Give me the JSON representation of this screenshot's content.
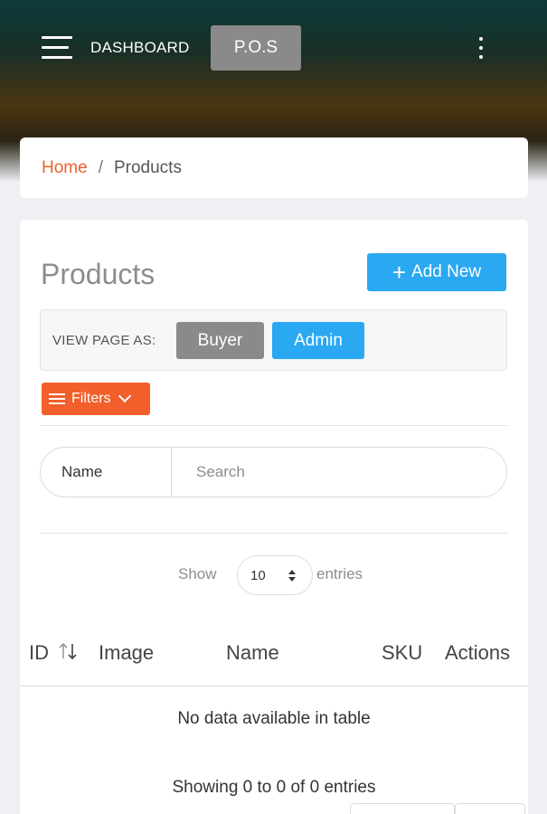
{
  "header": {
    "dashboard_label": "DASHBOARD",
    "pos_label": "P.O.S"
  },
  "breadcrumb": {
    "home": "Home",
    "separator": "/",
    "current": "Products"
  },
  "products": {
    "title": "Products",
    "add_new_label": "Add New",
    "view_page_as_label": "VIEW PAGE AS:",
    "buyer_label": "Buyer",
    "admin_label": "Admin",
    "filters_label": "Filters",
    "search": {
      "field_label": "Name",
      "placeholder": "Search"
    },
    "show_label": "Show",
    "entries_value": "10",
    "entries_label": "entries",
    "table": {
      "columns": [
        "ID",
        "Image",
        "Name",
        "SKU",
        "Actions"
      ],
      "empty_message": "No data available in table",
      "info": "Showing 0 to 0 of 0 entries"
    }
  },
  "colors": {
    "accent_orange": "#f25f2a",
    "accent_blue": "#2aa8f2",
    "button_gray": "#8a8a8a"
  },
  "icons": {
    "menu": "hamburger-menu-icon",
    "more": "kebab-menu-icon",
    "add": "plus-icon",
    "filters": "filter-lines-icon",
    "filters_toggle": "chevron-down-icon",
    "sort": "sort-arrows-icon",
    "select": "select-arrows-icon"
  }
}
